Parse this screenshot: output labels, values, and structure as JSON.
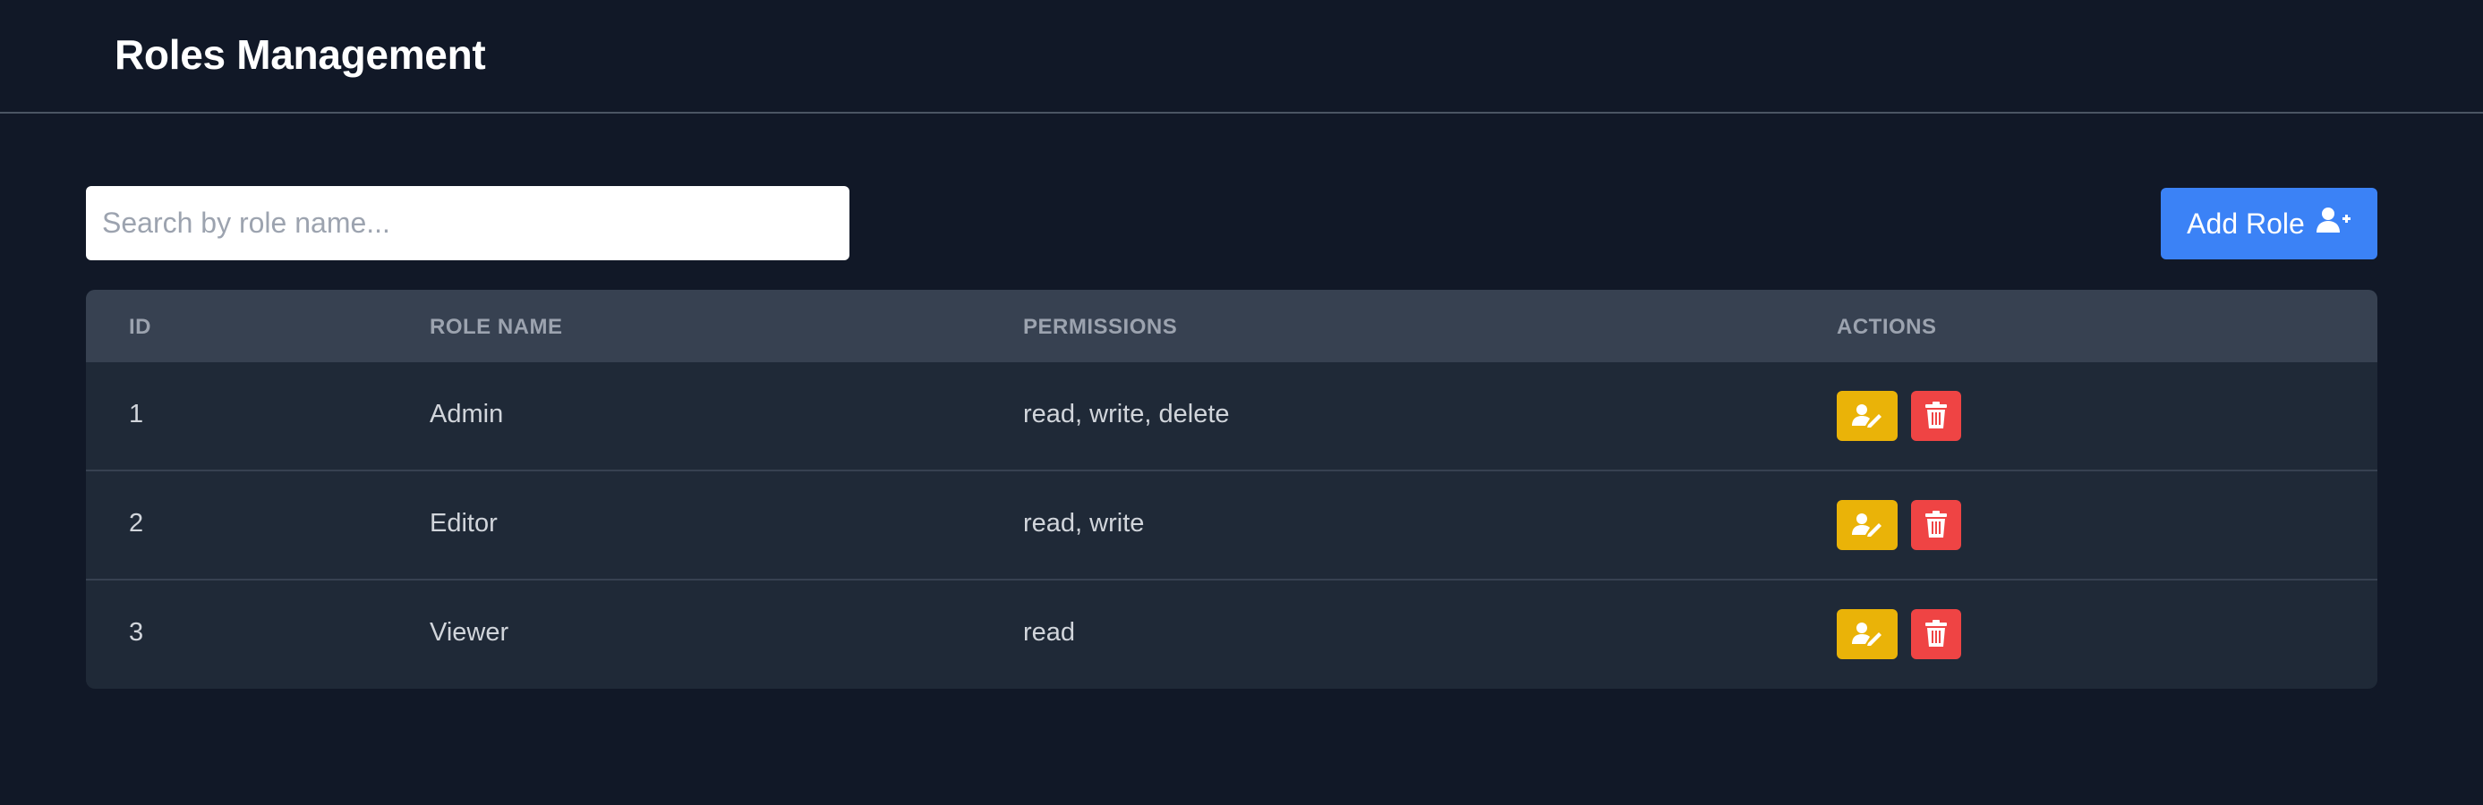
{
  "header": {
    "title": "Roles Management"
  },
  "search": {
    "placeholder": "Search by role name..."
  },
  "toolbar": {
    "add_label": "Add Role",
    "add_icon": "user-plus-icon"
  },
  "table": {
    "columns": [
      "ID",
      "ROLE NAME",
      "PERMISSIONS",
      "ACTIONS"
    ],
    "rows": [
      {
        "id": "1",
        "name": "Admin",
        "permissions": "read, write, delete"
      },
      {
        "id": "2",
        "name": "Editor",
        "permissions": "read, write"
      },
      {
        "id": "3",
        "name": "Viewer",
        "permissions": "read"
      }
    ],
    "row_actions": {
      "edit_icon": "user-edit-icon",
      "delete_icon": "trash-icon"
    }
  },
  "colors": {
    "background": "#111827",
    "accent": "#3b82f6",
    "edit": "#eab308",
    "delete": "#ef4444",
    "table_header": "#374151",
    "table_body": "#1f2937"
  }
}
